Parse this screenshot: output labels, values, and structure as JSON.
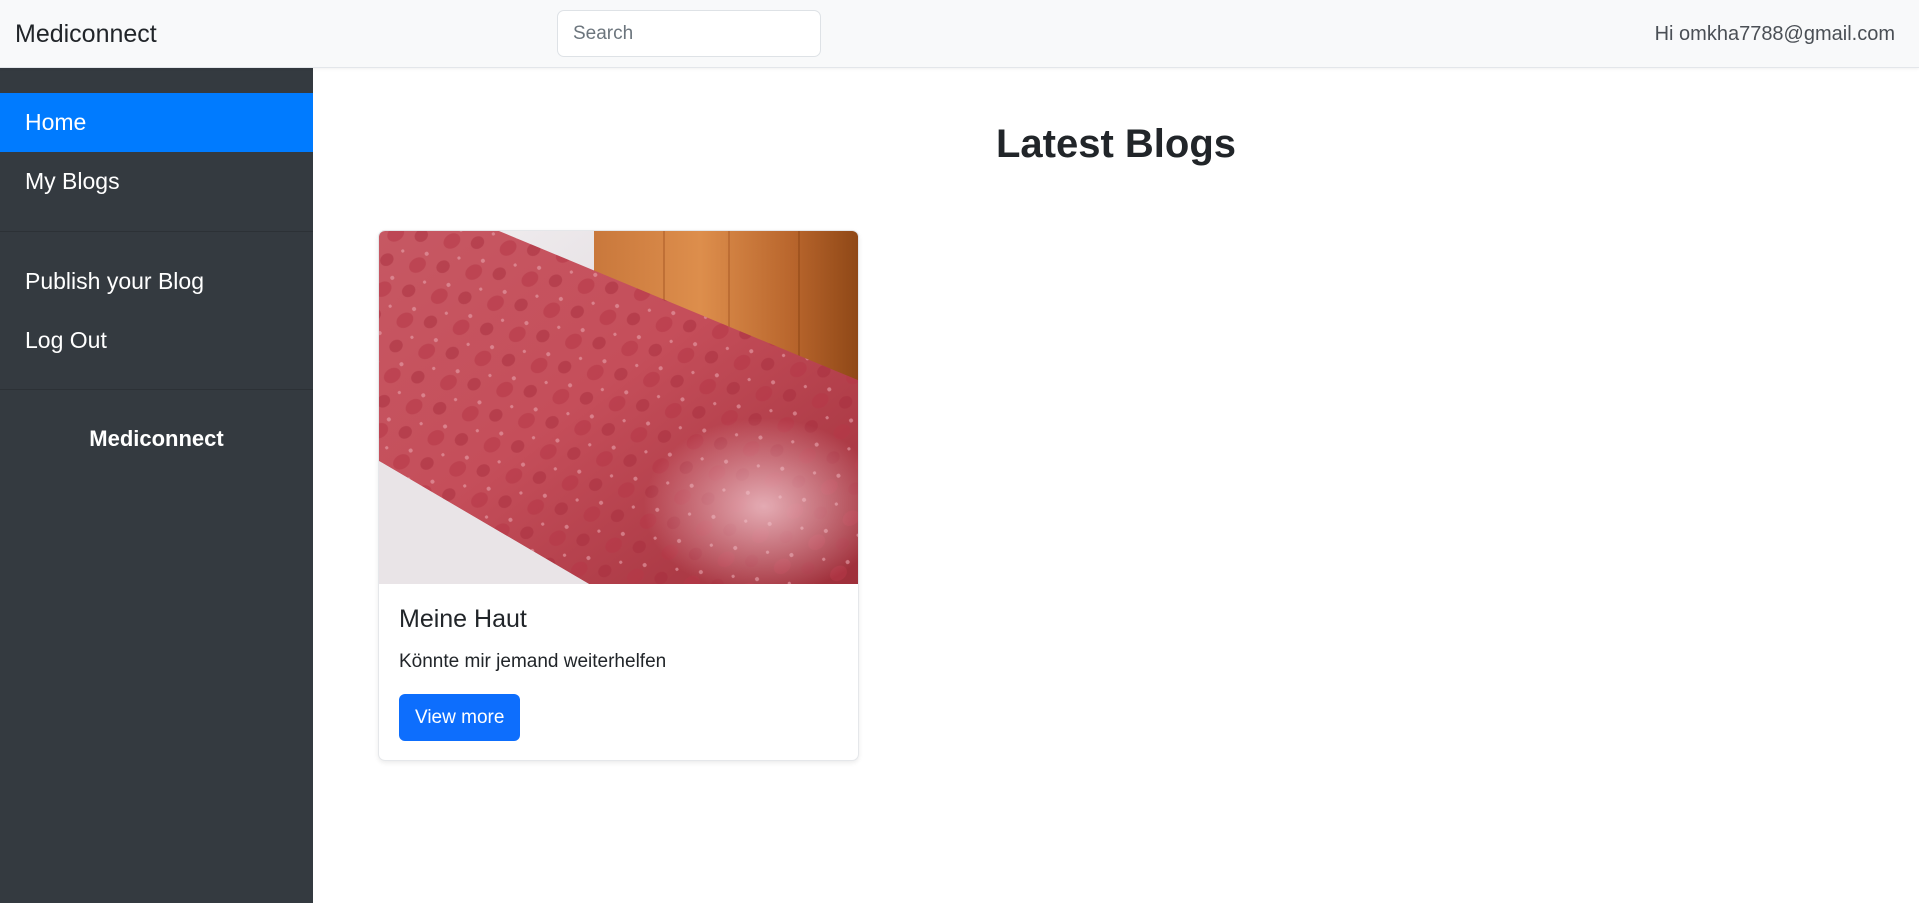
{
  "navbar": {
    "brand": "Mediconnect",
    "search_placeholder": "Search",
    "user_greeting": "Hi omkha7788@gmail.com"
  },
  "sidebar": {
    "items": [
      {
        "label": "Home",
        "active": true
      },
      {
        "label": "My Blogs",
        "active": false
      },
      {
        "label": "Publish your Blog",
        "active": false
      },
      {
        "label": "Log Out",
        "active": false
      }
    ],
    "footer": "Mediconnect"
  },
  "main": {
    "title": "Latest Blogs",
    "blogs": [
      {
        "title": "Meine Haut",
        "text": "Könnte mir jemand weiterhelfen",
        "button_label": "View more",
        "image": "skin-rash-photo"
      }
    ]
  },
  "colors": {
    "sidebar_bg": "#343a40",
    "active_nav": "#007bff",
    "primary_button": "#0d6efd",
    "navbar_bg": "#f8f9fa"
  }
}
